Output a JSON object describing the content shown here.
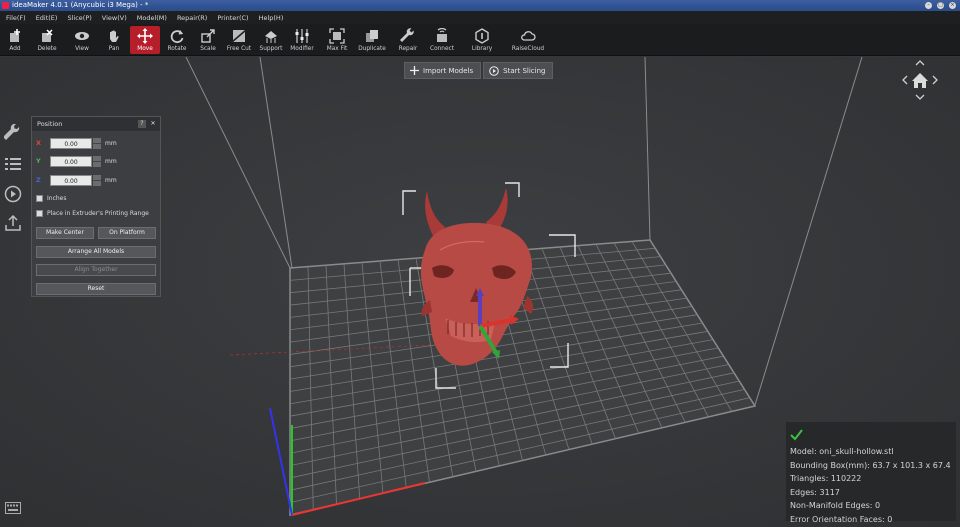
{
  "window": {
    "title": "ideaMaker 4.0.1 (Anycubic i3 Mega) - *"
  },
  "menu": [
    "File(F)",
    "Edit(E)",
    "Slice(P)",
    "View(V)",
    "Model(M)",
    "Repair(R)",
    "Printer(C)",
    "Help(H)"
  ],
  "toolbar": {
    "add": "Add",
    "delete": "Delete",
    "view": "View",
    "pan": "Pan",
    "move": "Move",
    "rotate": "Rotate",
    "scale": "Scale",
    "free_cut": "Free Cut",
    "support": "Support",
    "modifier": "Modifier",
    "max_fit": "Max Fit",
    "duplicate": "Duplicate",
    "repair": "Repair",
    "connect": "Connect",
    "library": "Library",
    "raisecloud": "RaiseCloud"
  },
  "viewport_buttons": {
    "import": "Import Models",
    "slice": "Start Slicing"
  },
  "position_panel": {
    "title": "Position",
    "help": "?",
    "close": "✕",
    "axes": [
      {
        "label": "X",
        "value": "0.00",
        "unit": "mm",
        "color": "#e0453a"
      },
      {
        "label": "Y",
        "value": "0.00",
        "unit": "mm",
        "color": "#4fb84a"
      },
      {
        "label": "Z",
        "value": "0.00",
        "unit": "mm",
        "color": "#4a63e0"
      }
    ],
    "inches": "Inches",
    "place_in_extruder": "Place in Extruder's Printing Range",
    "make_center": "Make Center",
    "on_platform": "On Platform",
    "arrange_all": "Arrange All Models",
    "align_together": "Align Together",
    "reset": "Reset"
  },
  "model_info": {
    "model": "Model: oni_skull-hollow.stl",
    "bounding_box": "Bounding Box(mm): 63.7 x 101.3 x 67.4",
    "triangles": "Triangles: 110222",
    "edges": "Edges: 3117",
    "non_manifold": "Non-Manifold Edges: 0",
    "error_faces": "Error Orientation Faces: 0"
  },
  "colors": {
    "accent": "#b61e2a",
    "model": "#b5433f",
    "check": "#3fbf3f"
  }
}
